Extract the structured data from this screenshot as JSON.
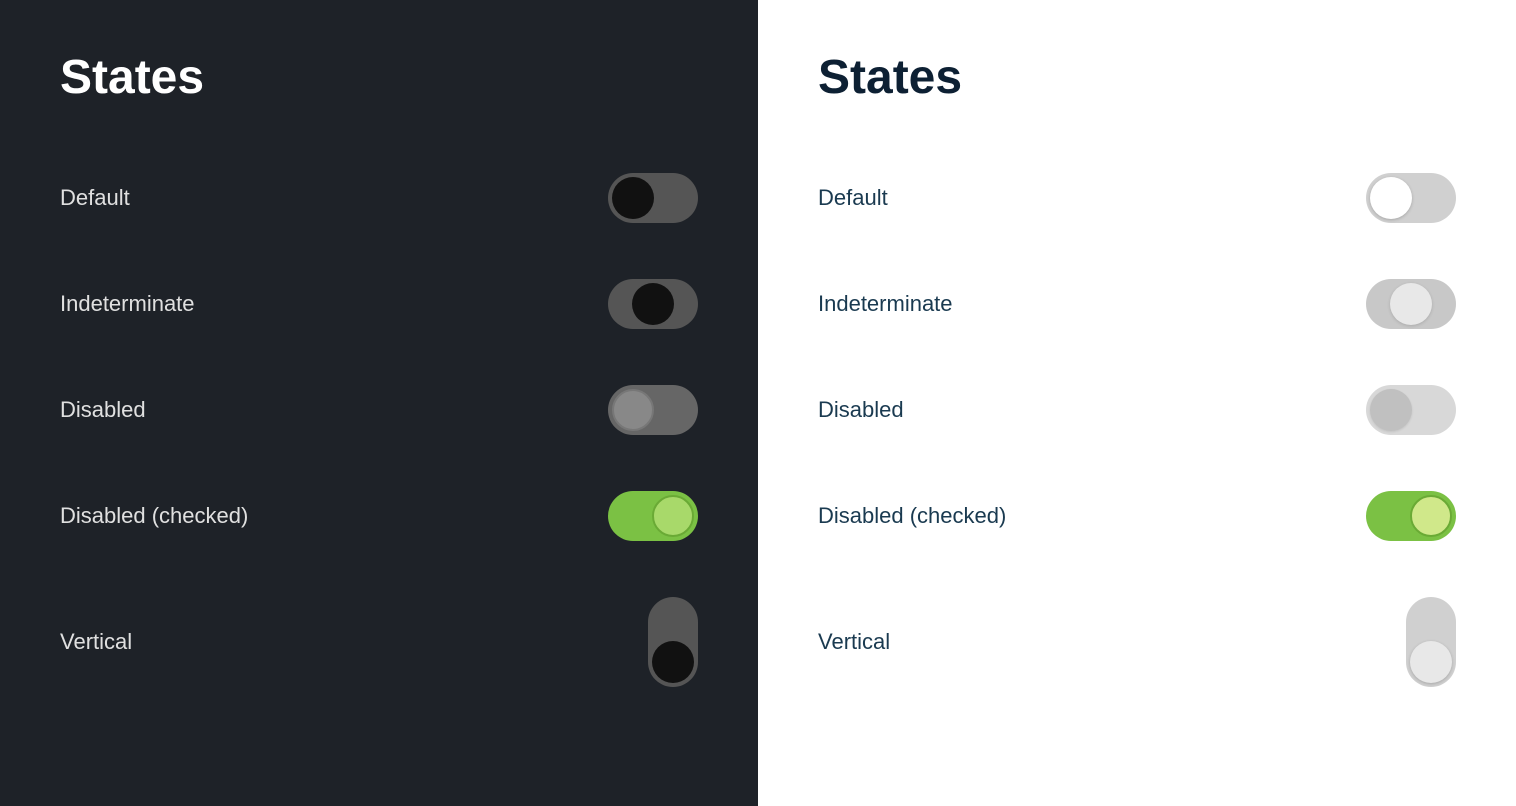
{
  "darkPanel": {
    "title": "States",
    "rows": [
      {
        "id": "default",
        "label": "Default"
      },
      {
        "id": "indeterminate",
        "label": "Indeterminate"
      },
      {
        "id": "disabled",
        "label": "Disabled"
      },
      {
        "id": "disabled-checked",
        "label": "Disabled (checked)"
      },
      {
        "id": "vertical",
        "label": "Vertical"
      }
    ]
  },
  "lightPanel": {
    "title": "States",
    "rows": [
      {
        "id": "default",
        "label": "Default"
      },
      {
        "id": "indeterminate",
        "label": "Indeterminate"
      },
      {
        "id": "disabled",
        "label": "Disabled"
      },
      {
        "id": "disabled-checked",
        "label": "Disabled (checked)"
      },
      {
        "id": "vertical",
        "label": "Vertical"
      }
    ]
  }
}
